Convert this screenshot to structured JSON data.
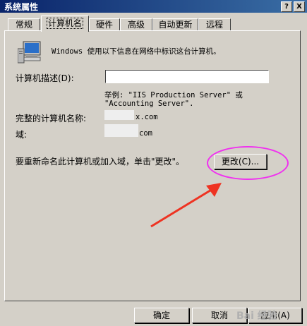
{
  "window": {
    "title": "系统属性",
    "help_label": "?",
    "close_label": "X"
  },
  "tabs": [
    {
      "label": "常规"
    },
    {
      "label": "计算机名"
    },
    {
      "label": "硬件"
    },
    {
      "label": "高级"
    },
    {
      "label": "自动更新"
    },
    {
      "label": "远程"
    }
  ],
  "panel": {
    "intro": "Windows 使用以下信息在网络中标识这台计算机。",
    "description_label": "计算机描述(D):",
    "description_value": "",
    "example_line1": "举例: \"IIS Production Server\" 或",
    "example_line2": "\"Accounting Server\".",
    "full_name_label": "完整的计算机名称:",
    "full_name_value": "x.com",
    "domain_label": "域:",
    "domain_value": "com",
    "rename_text": "要重新命名此计算机或加入域，单击\"更改\"。",
    "change_button": "更改(C)..."
  },
  "footer": {
    "ok": "确定",
    "cancel": "取消",
    "apply": "应用(A)"
  },
  "watermark": "Bai 经验"
}
